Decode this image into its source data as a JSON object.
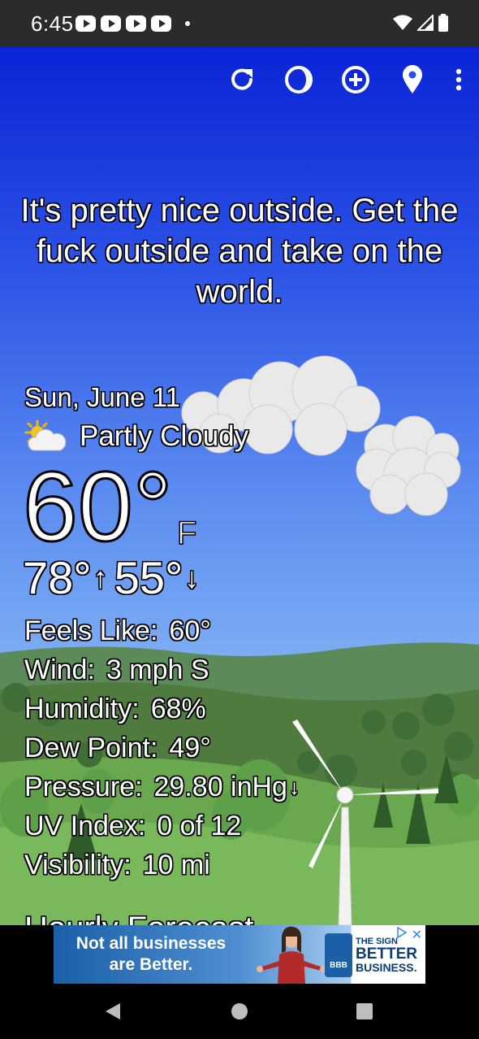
{
  "status_bar": {
    "time": "6:45",
    "notification_icons": [
      "youtube-icon",
      "youtube-icon",
      "youtube-icon",
      "youtube-icon"
    ],
    "right_icons": [
      "wifi-icon",
      "cell-signal-icon",
      "battery-icon"
    ]
  },
  "toolbar": {
    "buttons": [
      "refresh-icon",
      "theme-icon",
      "add-location-icon",
      "location-pin-icon",
      "more-menu-icon"
    ]
  },
  "headline": "It's pretty nice outside. Get the fuck outside and take on the world.",
  "current": {
    "date": "Sun, June 11",
    "condition_icon": "partly-cloudy-icon",
    "condition": "Partly Cloudy",
    "temperature": "60°",
    "unit": "F",
    "high": "78°",
    "low": "55°",
    "high_arrow": "↑",
    "low_arrow": "↓"
  },
  "details": {
    "feels_like": {
      "label": "Feels Like",
      "value": "60°"
    },
    "wind": {
      "label": "Wind",
      "value": "3 mph S"
    },
    "humidity": {
      "label": "Humidity",
      "value": "68%"
    },
    "dew_point": {
      "label": "Dew Point",
      "value": "49°"
    },
    "pressure": {
      "label": "Pressure",
      "value": "29.80 inHg",
      "trend": "↓"
    },
    "uv_index": {
      "label": "UV Index",
      "value": "0 of 12"
    },
    "visibility": {
      "label": "Visibility",
      "value": "10 mi"
    }
  },
  "hourly_title": "Hourly Forecast",
  "ad": {
    "line1": "Not all businesses",
    "line2": "are Better.",
    "logo_text": "BBB",
    "brand_line1": "THE SIGN",
    "brand_line2": "BETTER",
    "brand_line3": "BUSINESS.",
    "close": "✕"
  },
  "nav_bar": {
    "buttons": [
      "back-icon",
      "home-icon",
      "recents-icon"
    ]
  },
  "colors": {
    "sky_top": "#0b23d6",
    "sky_bottom": "#a6d0f4",
    "status_bar": "#2b2b2b",
    "hill_green": "#6aa84f"
  }
}
